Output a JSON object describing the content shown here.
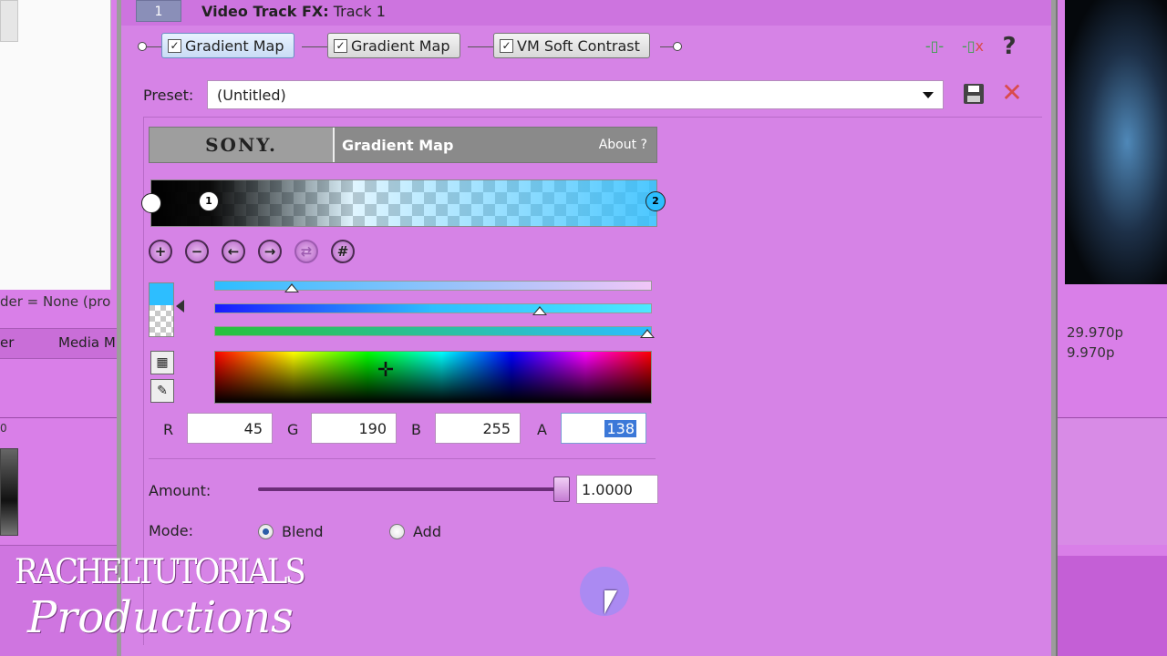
{
  "background": {
    "render_text": "der = None (pro",
    "tabs": [
      "er",
      "Media M"
    ],
    "ruler_label": "0",
    "fps": [
      "29.970p",
      "9.970p"
    ]
  },
  "window": {
    "index": "1",
    "title_bold": "Video Track FX:",
    "title_rest": " Track 1"
  },
  "fx_chain": [
    {
      "label": "Gradient Map",
      "checked": true,
      "active": true
    },
    {
      "label": "Gradient Map",
      "checked": true,
      "active": false
    },
    {
      "label": "VM Soft Contrast",
      "checked": true,
      "active": false
    }
  ],
  "chain_icons": [
    "plugin-chain-icon",
    "remove-plugin-icon",
    "help-icon"
  ],
  "preset": {
    "label": "Preset:",
    "value": "(Untitled)"
  },
  "plugin": {
    "brand": "SONY.",
    "name": "Gradient Map",
    "about": "About ?"
  },
  "gradient": {
    "stops": [
      {
        "label": "",
        "position": 0.0
      },
      {
        "label": "1",
        "position": 0.12
      },
      {
        "label": "2",
        "position": 1.0
      }
    ],
    "colors": {
      "start": "#000000",
      "end": "#2dbeff"
    }
  },
  "stop_tools": [
    "add-stop-icon",
    "remove-stop-icon",
    "move-left-icon",
    "move-right-icon",
    "reverse-icon",
    "distribute-icon"
  ],
  "color": {
    "hue_slider": 0.17,
    "saturation_slider": 0.74,
    "alpha_slider": 1.0,
    "r_label": "R",
    "r": "45",
    "g_label": "G",
    "g": "190",
    "b_label": "B",
    "b": "255",
    "a_label": "A",
    "a": "138",
    "swatch": "#2dbeff"
  },
  "amount": {
    "label": "Amount:",
    "value": "1.0000",
    "level": 1.0
  },
  "mode": {
    "label": "Mode:",
    "options": [
      "Blend",
      "Add"
    ],
    "selected": "Blend"
  },
  "watermark": {
    "line1": "RACHELTUTORIALS",
    "line2": "Productions"
  }
}
